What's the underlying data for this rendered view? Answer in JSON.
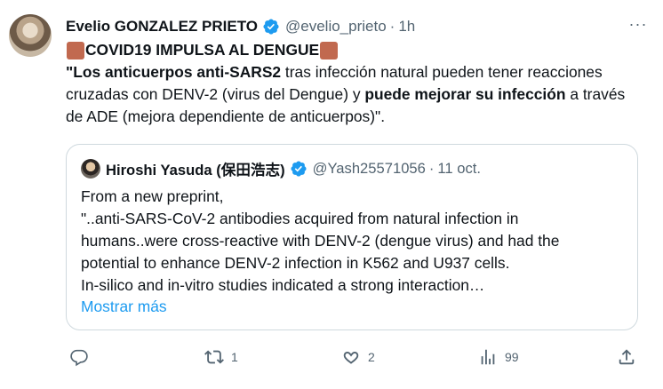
{
  "tweet": {
    "author_name": "Evelio GONZALEZ PRIETO",
    "handle": "@evelio_prieto",
    "separator": "·",
    "time": "1h",
    "more_icon": "more-horizontal-icon",
    "headline": "COVID19 IMPULSA AL DENGUE",
    "emoji_icon": "brown-square-emoji",
    "body": {
      "part1_bold": "\"Los anticuerpos anti-SARS2",
      "part2": " tras infección natural pueden tener reacciones cruzadas con DENV-2 (virus del Dengue) y ",
      "part3_bold": "puede mejorar su infección",
      "part4": " a través de ADE (mejora dependiente de anticuerpos)\"."
    }
  },
  "quoted_tweet": {
    "author_name": "Hiroshi Yasuda (保田浩志)",
    "handle": "@Yash25571056",
    "separator": "·",
    "time": "11 oct.",
    "lines": [
      "From a new preprint,",
      "\"..anti-SARS-CoV-2 antibodies acquired from natural infection in",
      "humans..were cross-reactive with DENV-2 (dengue virus) and had the",
      "potential to enhance DENV-2 infection in K562 and U937 cells.",
      "In-silico and in-vitro studies indicated a strong interaction…"
    ],
    "show_more": "Mostrar más"
  },
  "actions": {
    "reply_count": "",
    "retweet_count": "1",
    "like_count": "2",
    "views_count": "99",
    "share_count": ""
  },
  "colors": {
    "verified": "#1d9bf0",
    "link": "#1d9bf0",
    "secondary_text": "#536471",
    "border": "#cfd9de",
    "emoji_square": "#c1694f"
  }
}
